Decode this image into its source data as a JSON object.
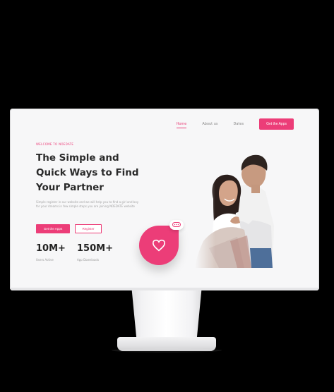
{
  "nav": {
    "items": [
      "Home",
      "About us",
      "Dates"
    ],
    "active": "Home",
    "cta": "Get the Apps"
  },
  "hero": {
    "eyebrow": "WELCOME TO NOEDATE",
    "headline_lines": [
      "The Simple and",
      "Quick Ways to Find",
      "Your Partner"
    ],
    "subtext": "Simple register in our website and we will help you to find a girl and boy for your dreams in few simple steps you are joining NOEDATE website",
    "primary_button": "Get the Apps",
    "secondary_button": "Register"
  },
  "stats": [
    {
      "value": "10M+",
      "label": "Users Active"
    },
    {
      "value": "150M+",
      "label": "App Downloads"
    }
  ],
  "colors": {
    "accent": "#ec3d78",
    "heading": "#2a2a2a",
    "background": "#f7f7f8"
  },
  "icons": {
    "heart": "heart-icon",
    "chat": "chat-bubble-icon"
  }
}
